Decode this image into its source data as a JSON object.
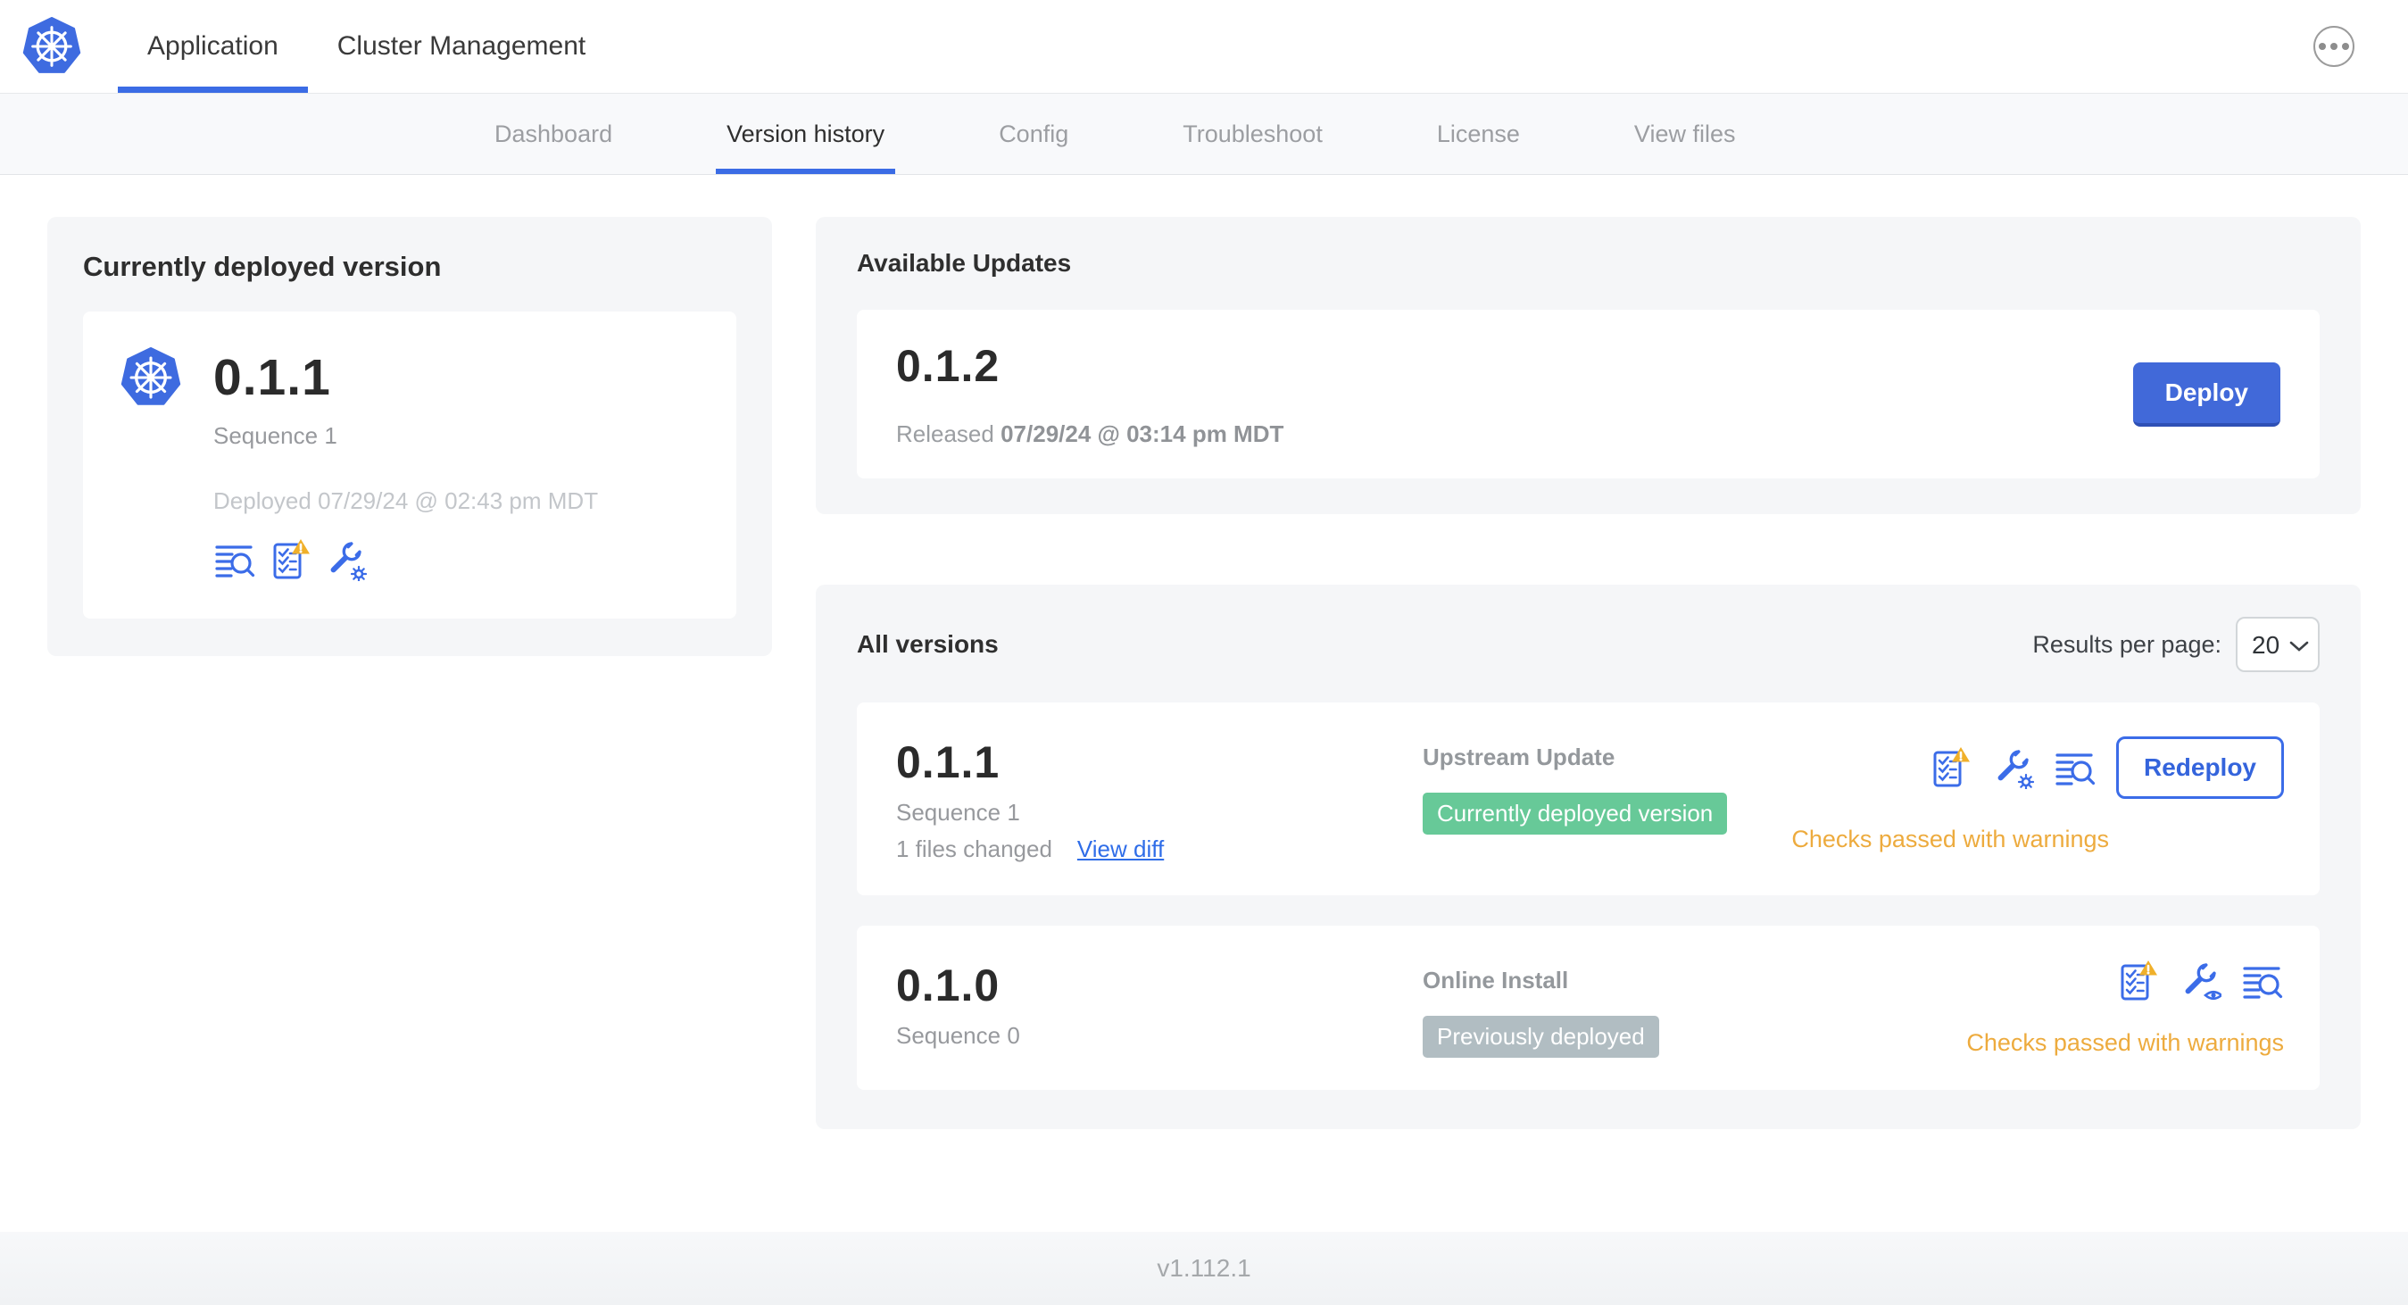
{
  "header": {
    "tabs": [
      {
        "label": "Application"
      },
      {
        "label": "Cluster Management"
      }
    ]
  },
  "subnav": {
    "tabs": [
      "Dashboard",
      "Version history",
      "Config",
      "Troubleshoot",
      "License",
      "View files"
    ],
    "active": "Version history"
  },
  "current_version_card": {
    "title": "Currently deployed version",
    "version": "0.1.1",
    "sequence": "Sequence 1",
    "deployed": "Deployed 07/29/24 @ 02:43 pm MDT"
  },
  "available_updates": {
    "title": "Available Updates",
    "version": "0.1.2",
    "released_prefix": "Released",
    "released_date": "07/29/24 @ 03:14 pm MDT",
    "deploy_label": "Deploy"
  },
  "all_versions": {
    "title": "All versions",
    "results_per_page_label": "Results per page:",
    "results_per_page_value": "20",
    "rows": [
      {
        "version": "0.1.1",
        "sequence": "Sequence 1",
        "files_changed": "1 files changed",
        "view_diff_label": "View diff",
        "source": "Upstream Update",
        "badge": "Currently deployed version",
        "status": "Checks passed with warnings",
        "action_label": "Redeploy"
      },
      {
        "version": "0.1.0",
        "sequence": "Sequence 0",
        "source": "Online Install",
        "badge": "Previously deployed",
        "status": "Checks passed with warnings"
      }
    ]
  },
  "footer": {
    "version": "v1.112.1"
  },
  "icons": {
    "kubernetes-logo": "blue heptagon with white helm wheel",
    "ellipsis-menu-icon": "three dots in circle",
    "log-search-icon": "text lines with magnifier",
    "preflight-checks-warning-icon": "checklist with warning triangle",
    "config-wrench-gear-icon": "wrench with gear",
    "config-wrench-eye-icon": "wrench with eye"
  },
  "colors": {
    "accent_blue": "#3b6ce8",
    "kubernetes_blue": "#3e6be0",
    "deploy_button": "#4169d9",
    "badge_green": "#67c998",
    "badge_gray": "#b1bdc2",
    "warning_orange": "#edab3e",
    "warning_triangle": "#f0b02a",
    "subnav_bg": "#f8f9fb",
    "card_bg": "#f5f6f8"
  }
}
